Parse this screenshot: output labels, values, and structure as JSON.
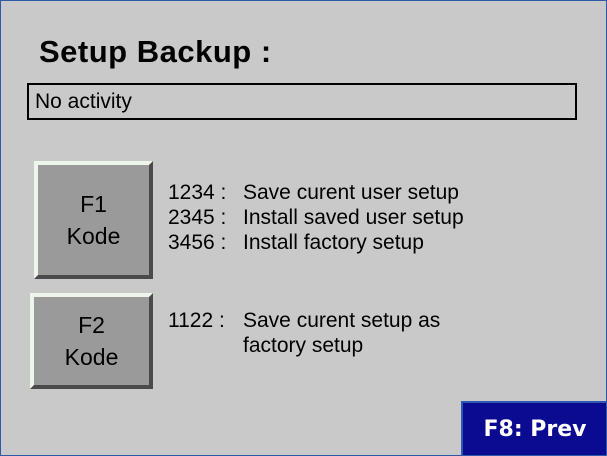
{
  "title": "Setup Backup :",
  "status": "No activity",
  "f1": {
    "line1": "F1",
    "line2": "Kode",
    "options": [
      {
        "code": "1234 :",
        "text": "Save curent user setup"
      },
      {
        "code": "2345 :",
        "text": "Install saved user setup"
      },
      {
        "code": "3456 :",
        "text": "Install factory setup"
      }
    ]
  },
  "f2": {
    "line1": "F2",
    "line2": "Kode",
    "option": {
      "code": "1122 :",
      "text": "Save curent setup as",
      "text2": "factory setup"
    }
  },
  "prev_label": "F8: Prev"
}
